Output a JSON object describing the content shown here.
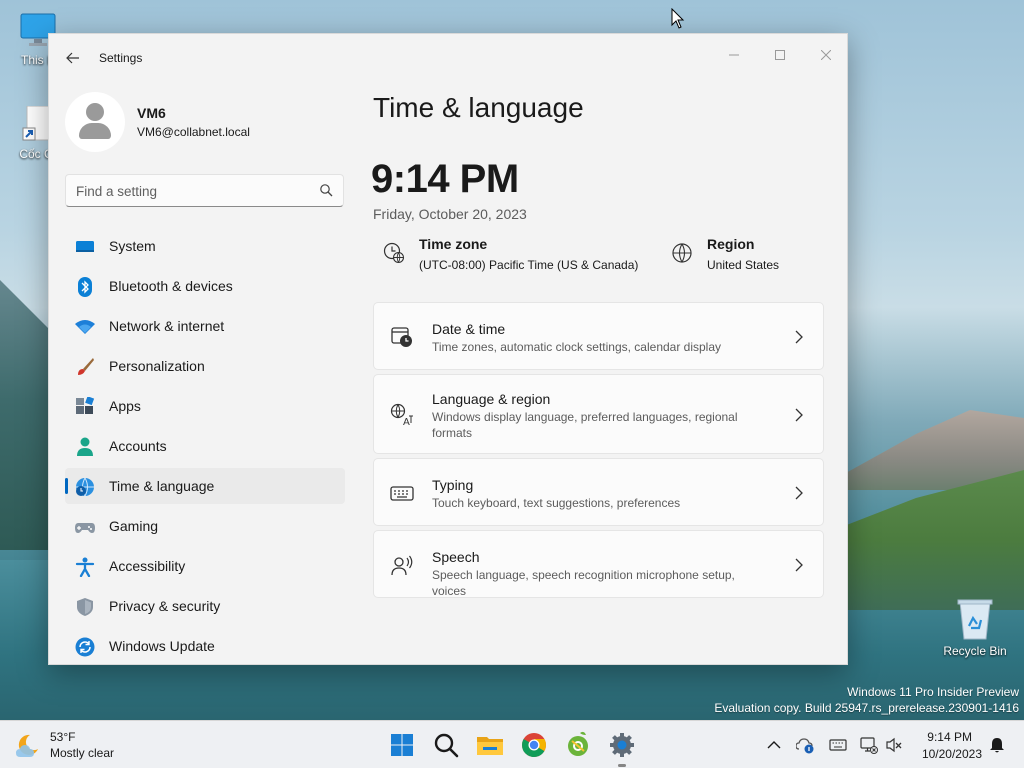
{
  "desktop": {
    "icons": [
      {
        "label": "This P",
        "icon": "monitor-icon"
      },
      {
        "label": "Cốc C",
        "icon": "shortcut-icon"
      }
    ],
    "recycle_bin": {
      "label": "Recycle Bin",
      "icon": "recycle-bin-icon"
    },
    "watermark": {
      "line1": "Windows 11 Pro Insider Preview",
      "line2": "Evaluation copy. Build 25947.rs_prerelease.230901-1416"
    }
  },
  "window": {
    "title": "Settings",
    "controls": {
      "minimize": "—",
      "maximize": "☐",
      "close": "✕"
    },
    "profile": {
      "name": "VM6",
      "email": "VM6@collabnet.local"
    },
    "search": {
      "placeholder": "Find a setting"
    },
    "nav": [
      {
        "label": "System",
        "icon": "system-icon"
      },
      {
        "label": "Bluetooth & devices",
        "icon": "bluetooth-icon"
      },
      {
        "label": "Network & internet",
        "icon": "wifi-icon"
      },
      {
        "label": "Personalization",
        "icon": "brush-icon"
      },
      {
        "label": "Apps",
        "icon": "apps-icon"
      },
      {
        "label": "Accounts",
        "icon": "accounts-icon"
      },
      {
        "label": "Time & language",
        "icon": "globe-clock-icon",
        "active": true
      },
      {
        "label": "Gaming",
        "icon": "gamepad-icon"
      },
      {
        "label": "Accessibility",
        "icon": "accessibility-icon"
      },
      {
        "label": "Privacy & security",
        "icon": "shield-icon"
      },
      {
        "label": "Windows Update",
        "icon": "update-icon"
      }
    ],
    "page": {
      "title": "Time & language",
      "clock": "9:14 PM",
      "date": "Friday, October 20, 2023",
      "time_zone": {
        "label": "Time zone",
        "value": "(UTC-08:00) Pacific Time (US & Canada)"
      },
      "region": {
        "label": "Region",
        "value": "United States"
      },
      "cards": [
        {
          "title": "Date & time",
          "desc": "Time zones, automatic clock settings, calendar display",
          "icon": "calendar-clock-icon"
        },
        {
          "title": "Language & region",
          "desc": "Windows display language, preferred languages, regional formats",
          "icon": "language-icon"
        },
        {
          "title": "Typing",
          "desc": "Touch keyboard, text suggestions, preferences",
          "icon": "keyboard-icon"
        },
        {
          "title": "Speech",
          "desc": "Speech language, speech recognition microphone setup, voices",
          "icon": "speech-icon"
        }
      ]
    }
  },
  "taskbar": {
    "weather": {
      "temp": "53°F",
      "condition": "Mostly clear"
    },
    "apps": [
      "start-icon",
      "search-icon",
      "file-explorer-icon",
      "chrome-icon",
      "coc-coc-icon",
      "settings-icon"
    ],
    "clock": {
      "time": "9:14 PM",
      "date": "10/20/2023"
    }
  },
  "colors": {
    "accent": "#0067c0",
    "window_bg": "#f3f3f3",
    "card_bg": "#fbfbfb"
  }
}
